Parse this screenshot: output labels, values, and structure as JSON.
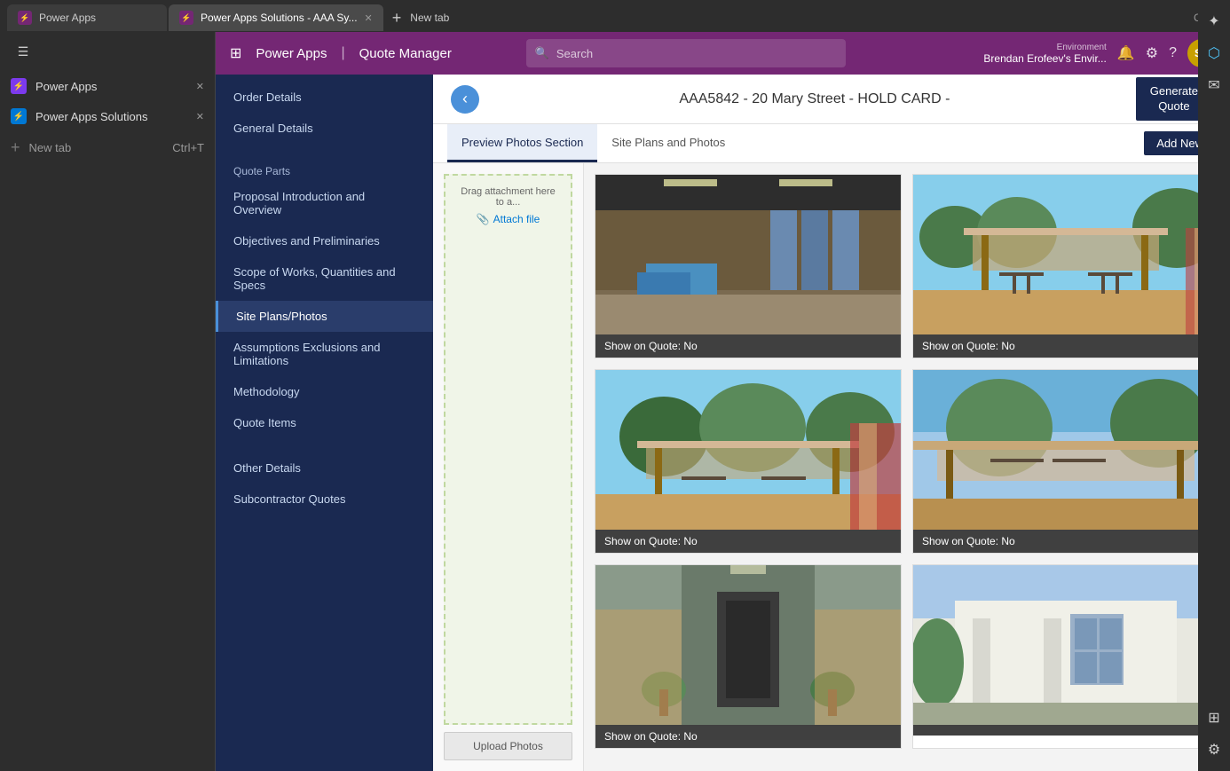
{
  "browser": {
    "tabs": [
      {
        "id": "tab1",
        "label": "Power Apps",
        "icon": "⚡",
        "closable": false,
        "active": false
      },
      {
        "id": "tab2",
        "label": "Power Apps Solutions - AAA Sy...",
        "icon": "⚡",
        "closable": true,
        "active": true
      }
    ],
    "new_tab_label": "New tab",
    "new_tab_shortcut": "Ctrl+T"
  },
  "powerapps": {
    "header": {
      "grid_icon": "⊞",
      "app_title": "Power Apps",
      "separator": "|",
      "app_name": "Quote Manager",
      "search_placeholder": "Search",
      "environment_label": "Environment",
      "environment_name": "Brendan Erofeev's Envir...",
      "avatar_initials": "SS"
    },
    "nav": {
      "sections": [
        {
          "items": [
            {
              "id": "order-details",
              "label": "Order Details"
            },
            {
              "id": "general-details",
              "label": "General Details"
            }
          ]
        },
        {
          "section_label": "Quote Parts",
          "items": [
            {
              "id": "proposal-intro",
              "label": "Proposal Introduction and Overview"
            },
            {
              "id": "objectives",
              "label": "Objectives and Preliminaries"
            },
            {
              "id": "scope-of-works",
              "label": "Scope of Works, Quantities and Specs"
            },
            {
              "id": "site-plans",
              "label": "Site Plans/Photos",
              "active": true
            },
            {
              "id": "assumptions",
              "label": "Assumptions Exclusions and Limitations"
            },
            {
              "id": "methodology",
              "label": "Methodology"
            },
            {
              "id": "quote-items",
              "label": "Quote Items"
            }
          ]
        },
        {
          "items": [
            {
              "id": "other-details",
              "label": "Other Details"
            },
            {
              "id": "subcontractor",
              "label": "Subcontractor Quotes"
            }
          ]
        }
      ]
    },
    "topbar": {
      "back_label": "‹",
      "title": "AAA5842 - 20 Mary Street - HOLD CARD -",
      "generate_button": "Generate\nQuote"
    },
    "tabs": [
      {
        "id": "preview-photos",
        "label": "Preview Photos Section",
        "active": true
      },
      {
        "id": "site-plans-photos",
        "label": "Site Plans and Photos",
        "active": false
      }
    ],
    "add_new_label": "Add New",
    "attach_panel": {
      "drag_text": "Drag attachment here to a...",
      "attach_link_icon": "📎",
      "attach_link_label": "Attach file",
      "upload_button": "Upload Photos"
    },
    "photos": [
      {
        "id": 1,
        "label": "Show on Quote: No",
        "bg_class": "photo-bg-1"
      },
      {
        "id": 2,
        "label": "Show on Quote: No",
        "bg_class": "photo-bg-2"
      },
      {
        "id": 3,
        "label": "Show on Quote: No",
        "bg_class": "photo-bg-3"
      },
      {
        "id": 4,
        "label": "Show on Quote: No",
        "bg_class": "photo-bg-4"
      },
      {
        "id": 5,
        "label": "Show on Quote: No",
        "bg_class": "photo-bg-5"
      },
      {
        "id": 6,
        "label": "",
        "bg_class": "photo-bg-6"
      }
    ]
  },
  "edge_icons": [
    "★",
    "✦",
    "✉",
    "⚙",
    "?"
  ]
}
